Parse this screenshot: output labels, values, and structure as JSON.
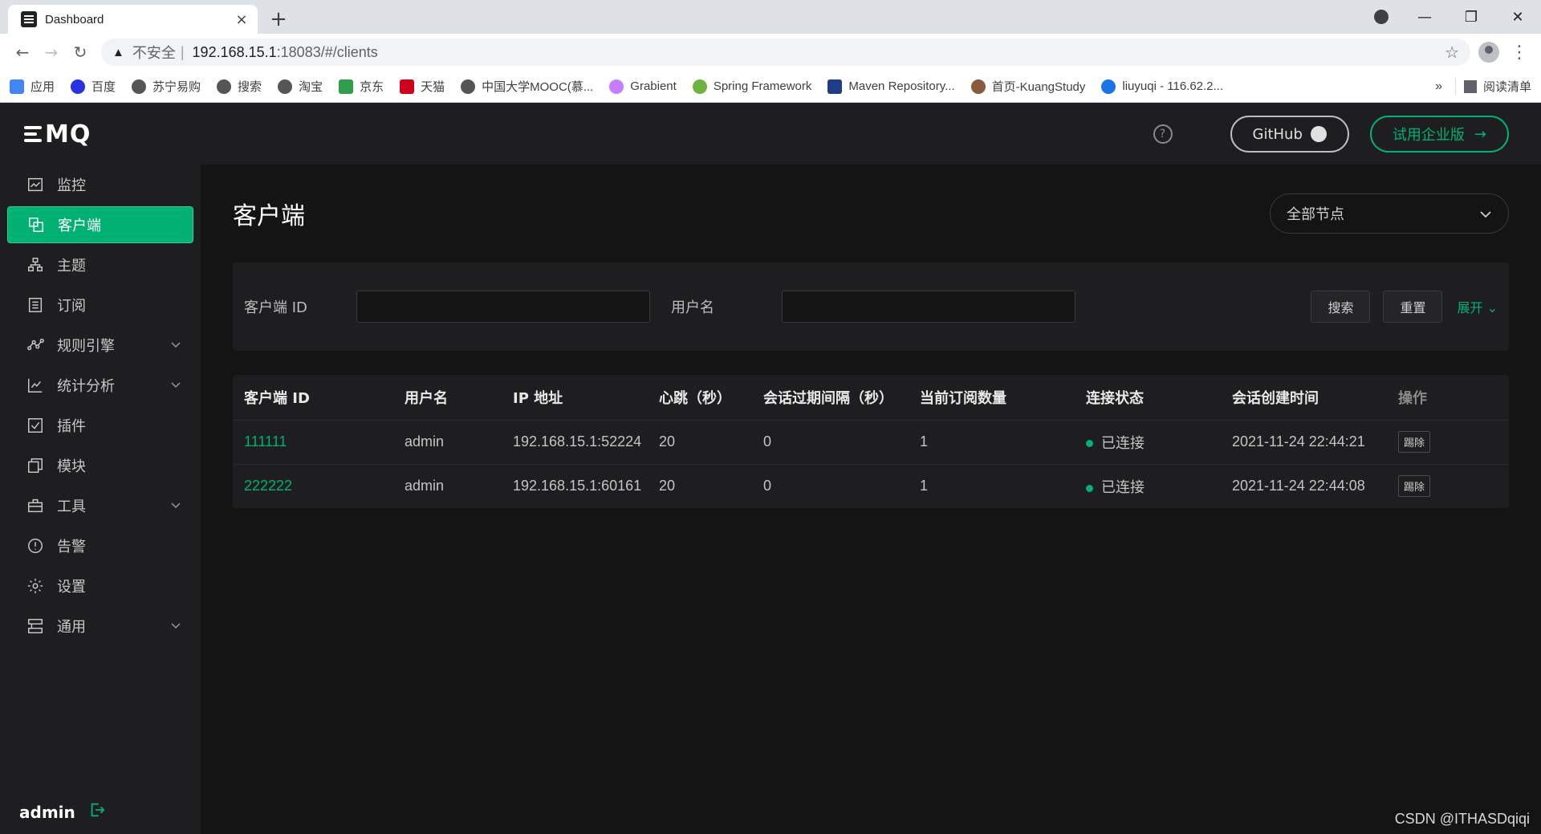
{
  "browser": {
    "tab_title": "Dashboard",
    "tab_close": "×",
    "new_tab": "+",
    "address": {
      "insecure_label": "不安全",
      "separator": "|",
      "host": "192.168.15.1",
      "path": ":18083/#/clients"
    },
    "bookmarks": [
      {
        "label": "应用",
        "color": "#4285f4"
      },
      {
        "label": "百度",
        "color": "#2932e1"
      },
      {
        "label": "苏宁易购",
        "color": "#555555"
      },
      {
        "label": "搜索",
        "color": "#555555"
      },
      {
        "label": "淘宝",
        "color": "#555555"
      },
      {
        "label": "京东",
        "color": "#2e9e4a"
      },
      {
        "label": "天猫",
        "color": "#d0021b"
      },
      {
        "label": "中国大学MOOC(慕...",
        "color": "#555555"
      },
      {
        "label": "Grabient",
        "color": "#c77dff"
      },
      {
        "label": "Spring Framework",
        "color": "#6db33f"
      },
      {
        "label": "Maven Repository...",
        "color": "#1f3c88"
      },
      {
        "label": "首页-KuangStudy",
        "color": "#8a5a3c"
      },
      {
        "label": "liuyuqi - 116.62.2...",
        "color": "#1a73e8"
      }
    ],
    "bookmarks_more": "»",
    "reading_list": "阅读清单"
  },
  "app": {
    "logo_text": "MQ",
    "menu": [
      {
        "key": "monitor",
        "label": "监控",
        "icon": "monitor-icon",
        "has_children": false,
        "active": false
      },
      {
        "key": "clients",
        "label": "客户端",
        "icon": "clients-icon",
        "has_children": false,
        "active": true
      },
      {
        "key": "topics",
        "label": "主题",
        "icon": "topics-icon",
        "has_children": false,
        "active": false
      },
      {
        "key": "subscriptions",
        "label": "订阅",
        "icon": "subscriptions-icon",
        "has_children": false,
        "active": false
      },
      {
        "key": "rules",
        "label": "规则引擎",
        "icon": "rules-icon",
        "has_children": true,
        "active": false
      },
      {
        "key": "analysis",
        "label": "统计分析",
        "icon": "analysis-icon",
        "has_children": true,
        "active": false
      },
      {
        "key": "plugins",
        "label": "插件",
        "icon": "plugins-icon",
        "has_children": false,
        "active": false
      },
      {
        "key": "modules",
        "label": "模块",
        "icon": "modules-icon",
        "has_children": false,
        "active": false
      },
      {
        "key": "tools",
        "label": "工具",
        "icon": "tools-icon",
        "has_children": true,
        "active": false
      },
      {
        "key": "alarms",
        "label": "告警",
        "icon": "alarms-icon",
        "has_children": false,
        "active": false
      },
      {
        "key": "settings",
        "label": "设置",
        "icon": "settings-icon",
        "has_children": false,
        "active": false
      },
      {
        "key": "general",
        "label": "通用",
        "icon": "general-icon",
        "has_children": true,
        "active": false
      }
    ],
    "user": "admin",
    "topbar": {
      "github_label": "GitHub",
      "enterprise_label": "试用企业版",
      "enterprise_arrow": "→"
    },
    "page": {
      "title": "客户端",
      "node_select": "全部节点"
    },
    "filter": {
      "client_id_label": "客户端 ID",
      "client_id_value": "",
      "username_label": "用户名",
      "username_value": "",
      "search_label": "搜索",
      "reset_label": "重置",
      "expand_label": "展开"
    },
    "table": {
      "columns": [
        "客户端 ID",
        "用户名",
        "IP 地址",
        "心跳（秒）",
        "会话过期间隔（秒）",
        "当前订阅数量",
        "连接状态",
        "会话创建时间",
        "操作"
      ],
      "rows": [
        {
          "client_id": "111111",
          "username": "admin",
          "ip": "192.168.15.1:52224",
          "keepalive": "20",
          "expiry": "0",
          "subs": "1",
          "status": "已连接",
          "created": "2021-11-24 22:44:21",
          "action": "踢除"
        },
        {
          "client_id": "222222",
          "username": "admin",
          "ip": "192.168.15.1:60161",
          "keepalive": "20",
          "expiry": "0",
          "subs": "1",
          "status": "已连接",
          "created": "2021-11-24 22:44:08",
          "action": "踢除"
        }
      ]
    },
    "accent_color": "#00b173"
  },
  "watermark": "CSDN @ITHASDqiqi"
}
